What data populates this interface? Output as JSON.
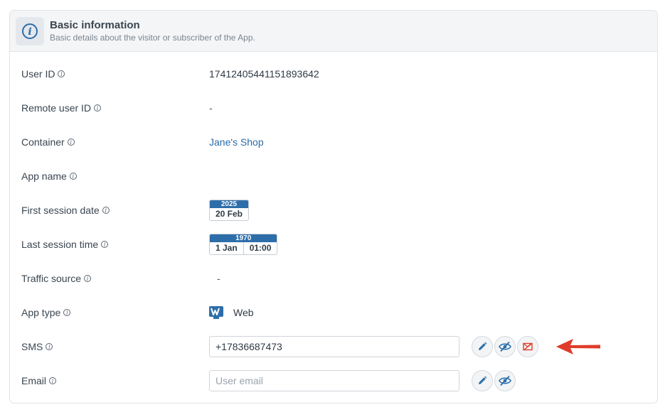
{
  "section": {
    "title": "Basic information",
    "subtitle": "Basic details about the visitor or subscriber of the App."
  },
  "fields": {
    "user_id": {
      "label": "User ID",
      "value": "17412405441151893642"
    },
    "remote_user_id": {
      "label": "Remote user ID",
      "value": "-"
    },
    "container": {
      "label": "Container",
      "value": "Jane's Shop"
    },
    "app_name": {
      "label": "App name",
      "value": ""
    },
    "first_session_date": {
      "label": "First session date",
      "year": "2025",
      "day": "20 Feb"
    },
    "last_session_time": {
      "label": "Last session time",
      "year": "1970",
      "day": "1 Jan",
      "time": "01:00"
    },
    "traffic_source": {
      "label": "Traffic source",
      "value": "-"
    },
    "app_type": {
      "label": "App type",
      "value": "Web",
      "icon": "web-app-icon"
    },
    "sms": {
      "label": "SMS",
      "value": "+17836687473",
      "placeholder": ""
    },
    "email": {
      "label": "Email",
      "value": "",
      "placeholder": "User email"
    }
  },
  "icons": {
    "header": "info-icon",
    "edit": "pencil-icon",
    "hide": "eye-slash-icon",
    "unsubscribe": "mail-blocked-icon",
    "annotation": "red-arrow-icon"
  },
  "colors": {
    "accent": "#2d6eaa",
    "link": "#2b6aa8",
    "alert": "#e03c2a"
  }
}
